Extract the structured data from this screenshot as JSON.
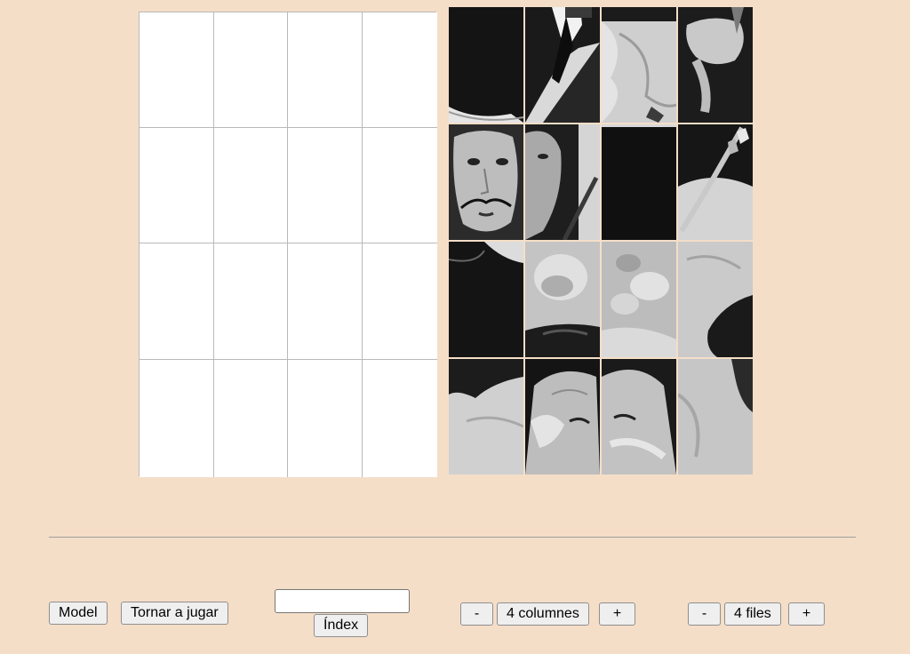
{
  "board": {
    "columns": 4,
    "rows": 4,
    "placed_pieces": 0
  },
  "pieces": [
    {
      "id": "p1",
      "motif": "dark-background-with-hat-brim",
      "tones": [
        "#141414",
        "#e8e8e8"
      ]
    },
    {
      "id": "p2",
      "motif": "collar-and-tie",
      "tones": [
        "#1a1a1a",
        "#d8d8d8"
      ]
    },
    {
      "id": "p3",
      "motif": "white-drapery-cane-tip",
      "tones": [
        "#cfcfcf",
        "#2a2a2a"
      ]
    },
    {
      "id": "p4",
      "motif": "hand-on-dark",
      "tones": [
        "#1c1c1c",
        "#c8c8c8"
      ]
    },
    {
      "id": "p5",
      "motif": "face-with-mustache",
      "tones": [
        "#2b2b2b",
        "#bdbdbd"
      ]
    },
    {
      "id": "p6",
      "motif": "face-side-and-cane",
      "tones": [
        "#1e1e1e",
        "#a9a9a9"
      ]
    },
    {
      "id": "p7",
      "motif": "solid-dark",
      "tones": [
        "#101010",
        "#181818"
      ]
    },
    {
      "id": "p8",
      "motif": "ornate-cane-head",
      "tones": [
        "#161616",
        "#d4d4d4"
      ]
    },
    {
      "id": "p9",
      "motif": "dark-shoulder",
      "tones": [
        "#141414",
        "#dcdcdc"
      ]
    },
    {
      "id": "p10",
      "motif": "marble-fist",
      "tones": [
        "#c4c4c4",
        "#e6e6e6"
      ]
    },
    {
      "id": "p11",
      "motif": "marble-fingers",
      "tones": [
        "#bcbcbc",
        "#e2e2e2"
      ]
    },
    {
      "id": "p12",
      "motif": "marble-with-dark-hair",
      "tones": [
        "#cacaca",
        "#1a1a1a"
      ]
    },
    {
      "id": "p13",
      "motif": "marble-shoulder",
      "tones": [
        "#d0d0d0",
        "#1c1c1c"
      ]
    },
    {
      "id": "p14",
      "motif": "marble-hand-on-head",
      "tones": [
        "#bdbdbd",
        "#141414"
      ]
    },
    {
      "id": "p15",
      "motif": "marble-beard-face",
      "tones": [
        "#c2c2c2",
        "#1a1a1a"
      ]
    },
    {
      "id": "p16",
      "motif": "marble-side",
      "tones": [
        "#c6c6c6",
        "#2a2a2a"
      ]
    }
  ],
  "controls": {
    "model_label": "Model",
    "replay_label": "Tornar a jugar",
    "index_input_value": "",
    "index_label": "Índex",
    "columns_minus": "-",
    "columns_value": "4 columnes",
    "columns_plus": "+",
    "rows_minus": "-",
    "rows_value": "4 files",
    "rows_plus": "+"
  }
}
